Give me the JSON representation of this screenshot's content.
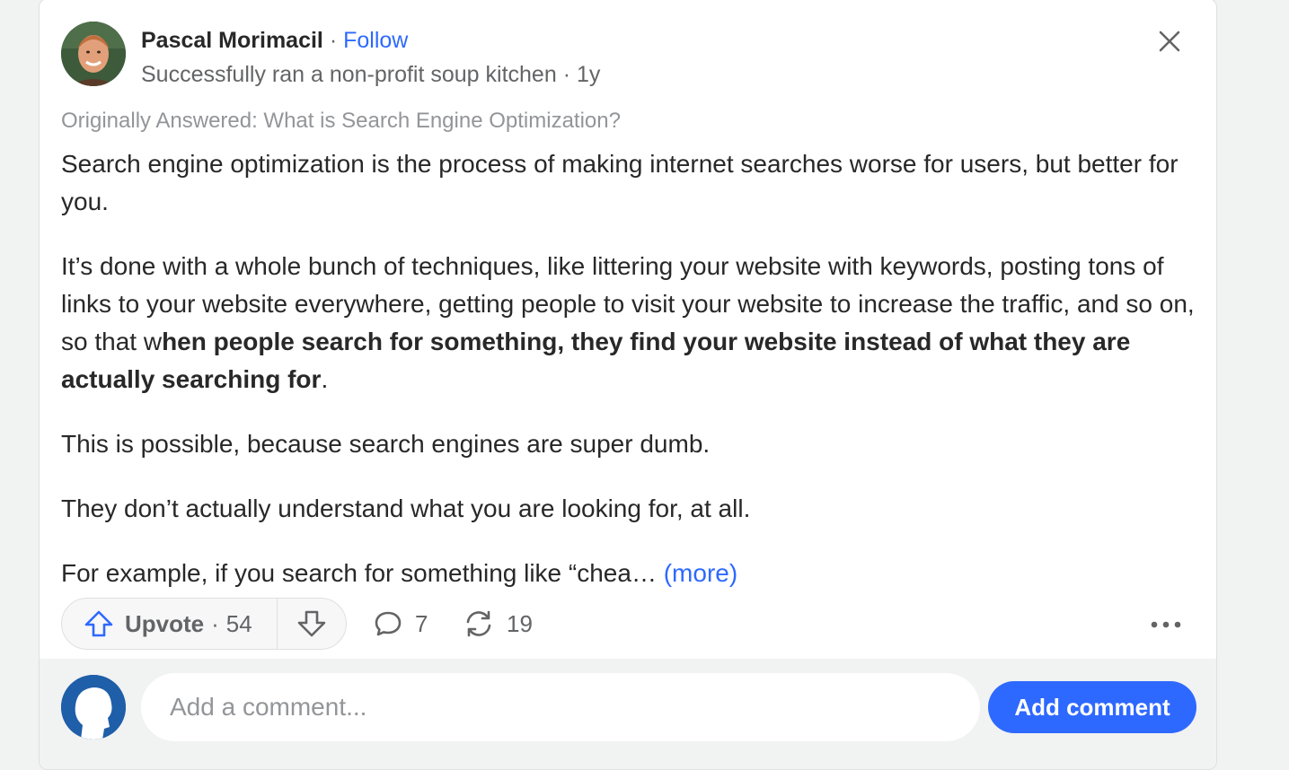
{
  "author": {
    "name": "Pascal Morimacil",
    "separator": "·",
    "follow_label": "Follow",
    "credential": "Successfully ran a non-profit soup kitchen · 1y"
  },
  "originally_answered": "Originally Answered: What is Search Engine Optimization?",
  "answer": {
    "p1": "Search engine optimization is the process of making internet searches worse for users, but better for you.",
    "p2_start": "It’s done with a whole bunch of techniques, like littering your website with keywords, posting tons of links to your website everywhere, getting people to visit your website to increase the traffic, and so on, so that w",
    "p2_bold": "hen people search for something, they find your website instead of what they are actually searching for",
    "p2_end": ".",
    "p3": "This is possible, because search engines are super dumb.",
    "p4": "They don’t actually understand what you are looking for, at all.",
    "p5": "For example, if you search for something like “chea… ",
    "more_label": "(more)"
  },
  "actions": {
    "upvote_label": "Upvote",
    "upvote_separator": "·",
    "upvote_count": "54",
    "comment_count": "7",
    "share_count": "19"
  },
  "comment_box": {
    "placeholder": "Add a comment...",
    "button_label": "Add comment"
  },
  "colors": {
    "accent": "#2e69ff",
    "text": "#282829",
    "muted": "#636466",
    "light_muted": "#939598",
    "avatar_blue": "#1f5ea8"
  },
  "icons": {
    "close": "close-icon",
    "upvote": "upvote-arrow-icon",
    "downvote": "downvote-arrow-icon",
    "comment": "comment-bubble-icon",
    "share": "share-rotate-icon",
    "more": "more-dots-icon"
  }
}
